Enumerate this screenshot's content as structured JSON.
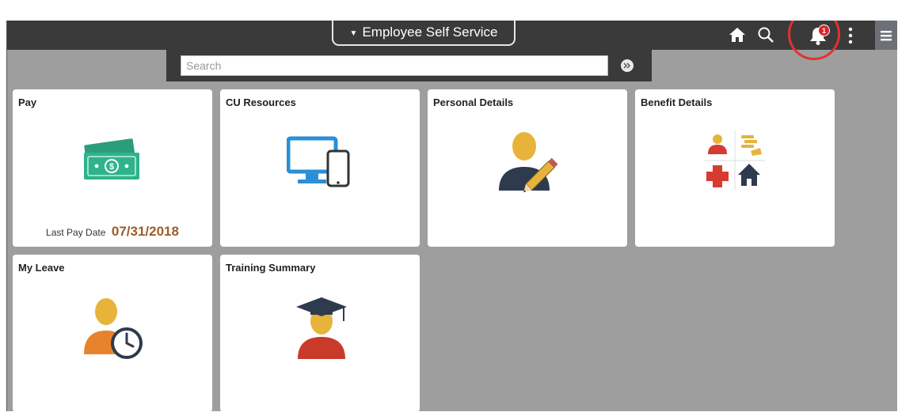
{
  "header": {
    "title": "Employee Self Service",
    "notification_count": "1"
  },
  "search": {
    "placeholder": "Search"
  },
  "tiles": [
    {
      "title": "Pay",
      "footer_label": "Last Pay Date",
      "footer_value": "07/31/2018"
    },
    {
      "title": "CU Resources"
    },
    {
      "title": "Personal Details"
    },
    {
      "title": "Benefit Details"
    },
    {
      "title": "My Leave"
    },
    {
      "title": "Training Summary"
    }
  ],
  "colors": {
    "header_bg": "#3a3a3a",
    "page_bg": "#9e9e9e",
    "pay_date": "#a05a2c",
    "highlight": "#e0332f",
    "badge": "#d7262b"
  },
  "icons": [
    "home-icon",
    "search-icon",
    "bell-icon",
    "kebab-icon",
    "hamburger-icon",
    "money-icon",
    "computer-phone-icon",
    "person-edit-icon",
    "benefits-icon",
    "person-clock-icon",
    "graduate-icon"
  ]
}
